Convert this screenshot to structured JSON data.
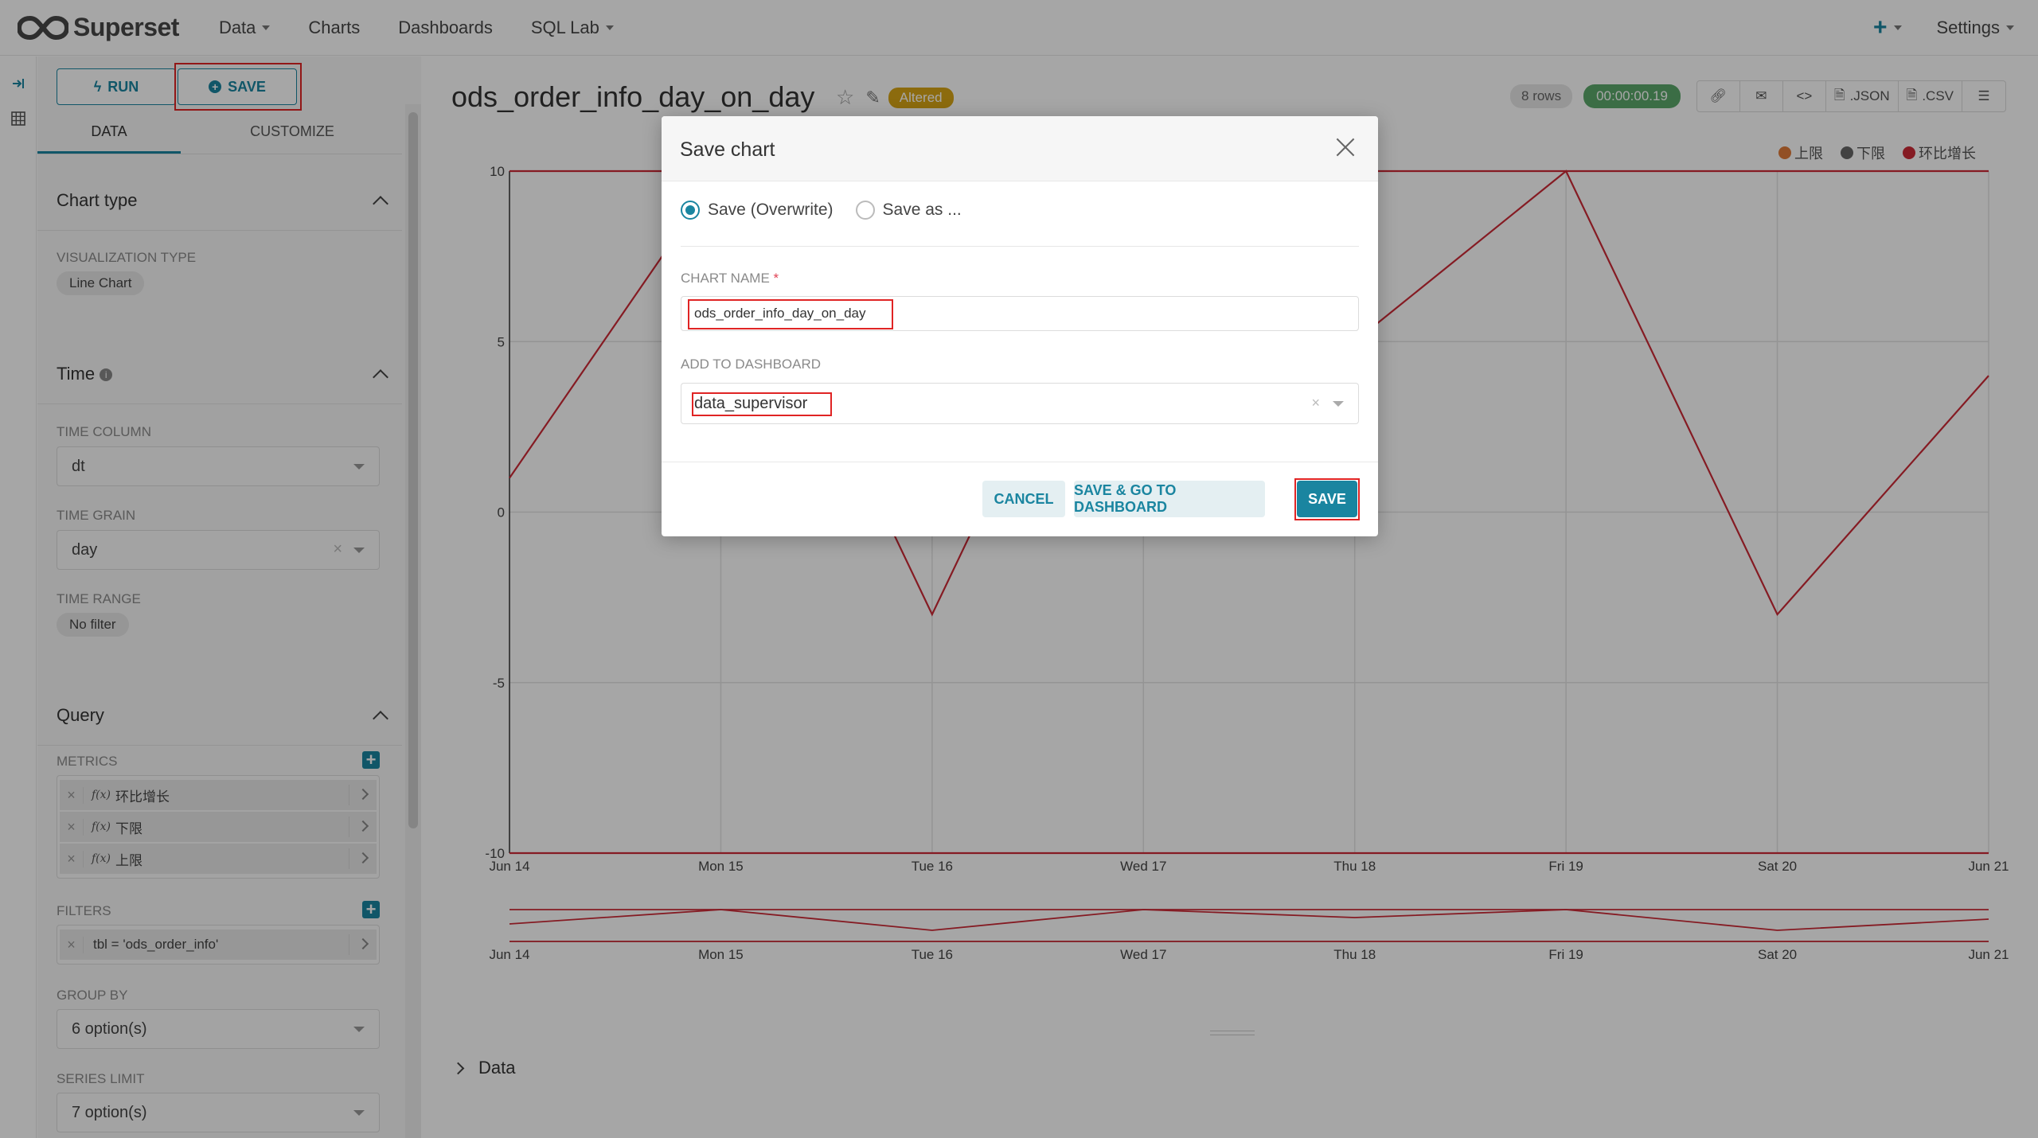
{
  "navbar": {
    "brand": "Superset",
    "items": [
      {
        "label": "Data",
        "dropdown": true
      },
      {
        "label": "Charts",
        "dropdown": false
      },
      {
        "label": "Dashboards",
        "dropdown": false
      },
      {
        "label": "SQL Lab",
        "dropdown": true
      }
    ],
    "plus": "+",
    "settings": "Settings"
  },
  "strip_icons": [
    "collapse-icon",
    "table-grid-icon"
  ],
  "control_panel": {
    "run_label": "RUN",
    "save_label": "SAVE",
    "tabs": [
      "DATA",
      "CUSTOMIZE"
    ],
    "chart_type": {
      "title": "Chart type",
      "viz_label": "VISUALIZATION TYPE",
      "viz_value": "Line Chart"
    },
    "time": {
      "title": "Time",
      "column_label": "TIME COLUMN",
      "column_value": "dt",
      "grain_label": "TIME GRAIN",
      "grain_value": "day",
      "range_label": "TIME RANGE",
      "range_value": "No filter"
    },
    "query": {
      "title": "Query",
      "metrics_label": "METRICS",
      "metrics": [
        "环比增长",
        "下限",
        "上限"
      ],
      "fx": "f(x)",
      "filters_label": "FILTERS",
      "filters": [
        "tbl = 'ods_order_info'"
      ],
      "groupby_label": "GROUP BY",
      "groupby_value": "6 option(s)",
      "series_limit_label": "SERIES LIMIT",
      "series_limit_value": "7 option(s)"
    }
  },
  "header": {
    "title": "ods_order_info_day_on_day",
    "altered": "Altered",
    "rows": "8 rows",
    "timer": "00:00:00.19",
    "actions": [
      ".JSON",
      ".CSV"
    ]
  },
  "chart_data": {
    "type": "line",
    "x": [
      "Jun 14",
      "Mon 15",
      "Tue 16",
      "Wed 17",
      "Thu 18",
      "Fri 19",
      "Sat 20",
      "Jun 21"
    ],
    "yticks": [
      "10",
      "5",
      "0",
      "-5",
      "-10"
    ],
    "ylim": [
      -10,
      10
    ],
    "legend_position": "top-right",
    "series": [
      {
        "name": "上限",
        "color": "#e07b39",
        "values": [
          10,
          10,
          10,
          10,
          10,
          10,
          10,
          10
        ]
      },
      {
        "name": "下限",
        "color": "#666666",
        "values": [
          -10,
          -10,
          -10,
          -10,
          -10,
          -10,
          -10,
          -10
        ]
      },
      {
        "name": "环比增长",
        "color": "#cc2a36",
        "values": [
          1,
          10,
          -3,
          10,
          5,
          10,
          -3,
          4
        ]
      }
    ]
  },
  "data_section": "Data",
  "modal": {
    "title": "Save chart",
    "option_overwrite": "Save (Overwrite)",
    "option_save_as": "Save as ...",
    "name_label": "CHART NAME",
    "required": "*",
    "name_value": "ods_order_info_day_on_day",
    "dashboard_label": "ADD TO DASHBOARD",
    "dashboard_value": "data_supervisor",
    "cancel": "CANCEL",
    "save_go": "SAVE & GO TO DASHBOARD",
    "save": "SAVE"
  }
}
